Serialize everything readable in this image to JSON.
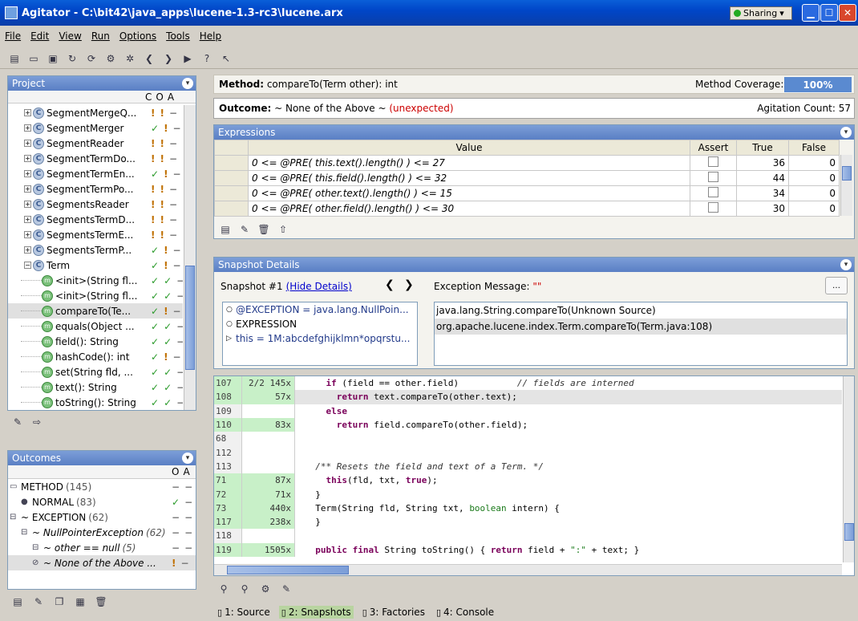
{
  "window": {
    "title": "Agitator - C:\\bit42\\java_apps\\lucene-1.3-rc3\\lucene.arx",
    "sharing": "Sharing"
  },
  "menu": [
    "File",
    "Edit",
    "View",
    "Run",
    "Options",
    "Tools",
    "Help"
  ],
  "project": {
    "title": "Project",
    "cols": [
      "C",
      "O",
      "A"
    ],
    "items": [
      {
        "name": "SegmentMergeQ...",
        "c": "!",
        "o": "!",
        "a": "−",
        "type": "class"
      },
      {
        "name": "SegmentMerger",
        "c": "✓",
        "o": "!",
        "a": "−",
        "type": "class"
      },
      {
        "name": "SegmentReader",
        "c": "!",
        "o": "!",
        "a": "−",
        "type": "class"
      },
      {
        "name": "SegmentTermDo...",
        "c": "!",
        "o": "!",
        "a": "−",
        "type": "class"
      },
      {
        "name": "SegmentTermEn...",
        "c": "✓",
        "o": "!",
        "a": "−",
        "type": "class"
      },
      {
        "name": "SegmentTermPo...",
        "c": "!",
        "o": "!",
        "a": "−",
        "type": "class"
      },
      {
        "name": "SegmentsReader",
        "c": "!",
        "o": "!",
        "a": "−",
        "type": "class"
      },
      {
        "name": "SegmentsTermD...",
        "c": "!",
        "o": "!",
        "a": "−",
        "type": "class"
      },
      {
        "name": "SegmentsTermE...",
        "c": "!",
        "o": "!",
        "a": "−",
        "type": "class"
      },
      {
        "name": "SegmentsTermP...",
        "c": "✓",
        "o": "!",
        "a": "−",
        "type": "class"
      },
      {
        "name": "Term",
        "c": "✓",
        "o": "!",
        "a": "−",
        "type": "class-open"
      },
      {
        "name": "<init>(String fl...",
        "c": "✓",
        "o": "✓",
        "a": "−",
        "type": "method"
      },
      {
        "name": "<init>(String fl...",
        "c": "✓",
        "o": "✓",
        "a": "−",
        "type": "method"
      },
      {
        "name": "compareTo(Te...",
        "c": "✓",
        "o": "!",
        "a": "−",
        "type": "method",
        "sel": true
      },
      {
        "name": "equals(Object ...",
        "c": "✓",
        "o": "✓",
        "a": "−",
        "type": "method"
      },
      {
        "name": "field(): String",
        "c": "✓",
        "o": "✓",
        "a": "−",
        "type": "method"
      },
      {
        "name": "hashCode(): int",
        "c": "✓",
        "o": "!",
        "a": "−",
        "type": "method"
      },
      {
        "name": "set(String fld, ...",
        "c": "✓",
        "o": "✓",
        "a": "−",
        "type": "method"
      },
      {
        "name": "text(): String",
        "c": "✓",
        "o": "✓",
        "a": "−",
        "type": "method"
      },
      {
        "name": "toString(): String",
        "c": "✓",
        "o": "✓",
        "a": "−",
        "type": "method"
      }
    ]
  },
  "outcomes": {
    "title": "Outcomes",
    "cols": [
      "O",
      "A"
    ],
    "items": [
      {
        "label": "METHOD",
        "count": "(145)",
        "o": "−",
        "a": "−",
        "indent": 0
      },
      {
        "label": "NORMAL",
        "count": "(83)",
        "o": "✓",
        "a": "−",
        "indent": 1
      },
      {
        "label": "~ EXCEPTION",
        "count": "(62)",
        "o": "−",
        "a": "−",
        "indent": 0
      },
      {
        "label": "~ NullPointerException",
        "count": "(62)",
        "o": "−",
        "a": "−",
        "indent": 1,
        "italic": true
      },
      {
        "label": "~ other == null",
        "count": "(5)",
        "o": "−",
        "a": "−",
        "indent": 2,
        "italic": true
      },
      {
        "label": "~ None of the Above ...",
        "count": "",
        "o": "!",
        "a": "−",
        "indent": 2,
        "italic": true,
        "sel": true
      }
    ]
  },
  "method": {
    "label": "Method:",
    "value": "compareTo(Term other): int",
    "coverage_label": "Method Coverage:",
    "coverage": "100%"
  },
  "outcome": {
    "label": "Outcome:",
    "value": "~ None of the Above ~",
    "flag": "(unexpected)",
    "count_label": "Agitation Count:",
    "count": "57"
  },
  "expressions": {
    "title": "Expressions",
    "headers": [
      "Value",
      "Assert",
      "True",
      "False"
    ],
    "rows": [
      {
        "value": "0 <= @PRE( this.text().length() ) <= 27",
        "true": "36",
        "false": "0"
      },
      {
        "value": "0 <= @PRE( this.field().length() ) <= 32",
        "true": "44",
        "false": "0"
      },
      {
        "value": "0 <= @PRE( other.text().length() ) <= 15",
        "true": "34",
        "false": "0"
      },
      {
        "value": "0 <= @PRE( other.field().length() ) <= 30",
        "true": "30",
        "false": "0"
      }
    ]
  },
  "snapshot": {
    "title": "Snapshot Details",
    "label": "Snapshot #1",
    "hide": "(Hide Details)",
    "exc_label": "Exception Message:",
    "exc_value": "\"\"",
    "items": [
      "@EXCEPTION = java.lang.NullPoin...",
      "EXPRESSION",
      "this = 1M:abcdefghijklmn*opqrstu..."
    ],
    "stack": [
      "java.lang.String.compareTo(Unknown Source)",
      "org.apache.lucene.index.Term.compareTo(Term.java:108)"
    ]
  },
  "code": [
    {
      "ln": "107",
      "cnt": "2/2 145x",
      "green": true,
      "parts": [
        [
          "    ",
          ""
        ],
        [
          "if",
          "kw"
        ],
        [
          " (field == other.field)           ",
          ""
        ],
        [
          "// fields are interned",
          "cmt"
        ]
      ]
    },
    {
      "ln": "108",
      "cnt": "57x",
      "green": true,
      "sel": true,
      "parts": [
        [
          "      ",
          ""
        ],
        [
          "return",
          "kw"
        ],
        [
          " text.compareTo(other.text);",
          ""
        ]
      ]
    },
    {
      "ln": "109",
      "cnt": "",
      "green": false,
      "parts": [
        [
          "    ",
          ""
        ],
        [
          "else",
          "kw"
        ]
      ]
    },
    {
      "ln": "110",
      "cnt": "83x",
      "green": true,
      "parts": [
        [
          "      ",
          ""
        ],
        [
          "return",
          "kw"
        ],
        [
          " field.compareTo(other.field);",
          ""
        ]
      ]
    },
    {
      "ln": "68",
      "cnt": "",
      "green": false,
      "parts": [
        [
          "  ",
          ""
        ]
      ]
    },
    {
      "ln": "112",
      "cnt": "",
      "green": false,
      "parts": [
        [
          "",
          ""
        ]
      ]
    },
    {
      "ln": "113",
      "cnt": "",
      "green": false,
      "parts": [
        [
          "  ",
          ""
        ],
        [
          "/** Resets the field and text of a Term. */",
          "cmt"
        ]
      ]
    },
    {
      "ln": "71",
      "cnt": "87x",
      "green": true,
      "parts": [
        [
          "    ",
          ""
        ],
        [
          "this",
          "kw"
        ],
        [
          "(fld, txt, ",
          ""
        ],
        [
          "true",
          "kw"
        ],
        [
          ");",
          ""
        ]
      ]
    },
    {
      "ln": "72",
      "cnt": "71x",
      "green": true,
      "parts": [
        [
          "  }",
          ""
        ]
      ]
    },
    {
      "ln": "73",
      "cnt": "440x",
      "green": true,
      "parts": [
        [
          "  Term(String fld, String txt, ",
          ""
        ],
        [
          "boolean",
          "str"
        ],
        [
          " intern) {",
          ""
        ]
      ]
    },
    {
      "ln": "117",
      "cnt": "238x",
      "green": true,
      "parts": [
        [
          "  }",
          ""
        ]
      ]
    },
    {
      "ln": "118",
      "cnt": "",
      "green": false,
      "parts": [
        [
          "",
          ""
        ]
      ]
    },
    {
      "ln": "119",
      "cnt": "1505x",
      "green": true,
      "parts": [
        [
          "  ",
          ""
        ],
        [
          "public final",
          "kw"
        ],
        [
          " String toString() { ",
          ""
        ],
        [
          "return",
          "kw"
        ],
        [
          " field + ",
          ""
        ],
        [
          "\":\"",
          "str"
        ],
        [
          " + text; }",
          ""
        ]
      ]
    }
  ],
  "tabs": [
    {
      "label": "1: Source",
      "active": false
    },
    {
      "label": "2: Snapshots",
      "active": true
    },
    {
      "label": "3: Factories",
      "active": false
    },
    {
      "label": "4: Console",
      "active": false
    }
  ]
}
